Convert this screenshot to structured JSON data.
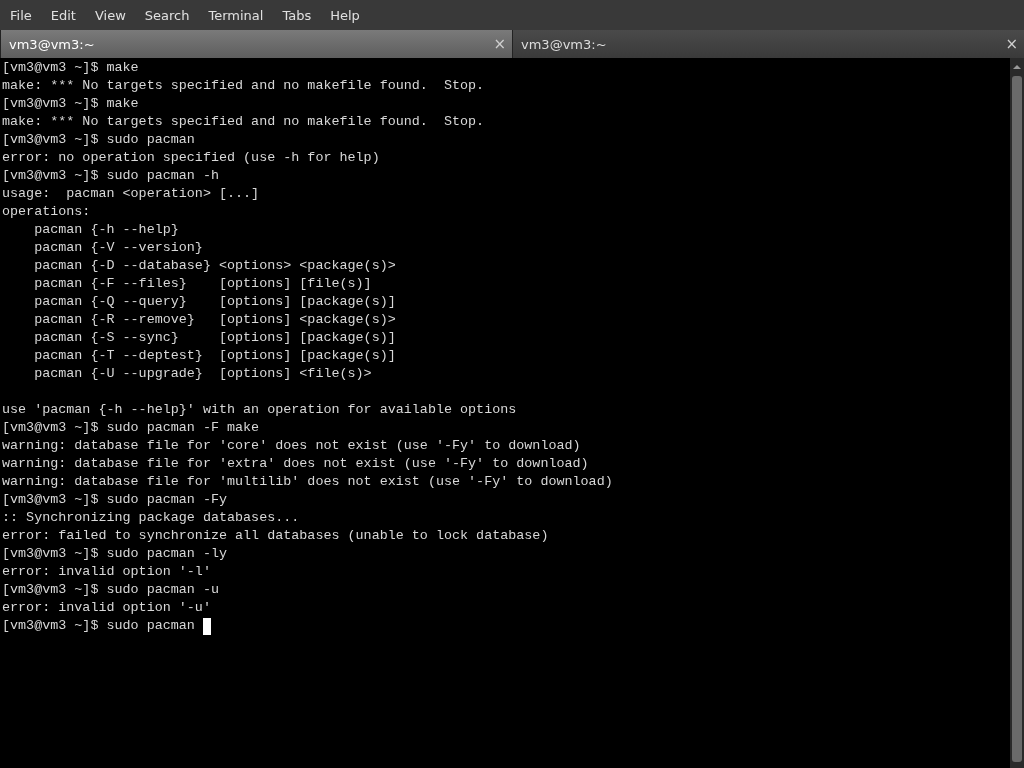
{
  "menu_bar": [
    "File",
    "Edit",
    "View",
    "Search",
    "Terminal",
    "Tabs",
    "Help"
  ],
  "tabs": [
    {
      "label": "vm3@vm3:~",
      "selected": true,
      "close": "×"
    },
    {
      "label": "vm3@vm3:~",
      "selected": false,
      "close": "×"
    }
  ],
  "terminal": {
    "lines": [
      {
        "text": "[vm3@vm3 ~]$ make",
        "cursor": false
      },
      {
        "text": "make: *** No targets specified and no makefile found.  Stop.",
        "cursor": false
      },
      {
        "text": "[vm3@vm3 ~]$ make",
        "cursor": false
      },
      {
        "text": "make: *** No targets specified and no makefile found.  Stop.",
        "cursor": false
      },
      {
        "text": "[vm3@vm3 ~]$ sudo pacman",
        "cursor": false
      },
      {
        "text": "error: no operation specified (use -h for help)",
        "cursor": false
      },
      {
        "text": "[vm3@vm3 ~]$ sudo pacman -h",
        "cursor": false
      },
      {
        "text": "usage:  pacman <operation> [...]",
        "cursor": false
      },
      {
        "text": "operations:",
        "cursor": false
      },
      {
        "text": "    pacman {-h --help}",
        "cursor": false
      },
      {
        "text": "    pacman {-V --version}",
        "cursor": false
      },
      {
        "text": "    pacman {-D --database} <options> <package(s)>",
        "cursor": false
      },
      {
        "text": "    pacman {-F --files}    [options] [file(s)]",
        "cursor": false
      },
      {
        "text": "    pacman {-Q --query}    [options] [package(s)]",
        "cursor": false
      },
      {
        "text": "    pacman {-R --remove}   [options] <package(s)>",
        "cursor": false
      },
      {
        "text": "    pacman {-S --sync}     [options] [package(s)]",
        "cursor": false
      },
      {
        "text": "    pacman {-T --deptest}  [options] [package(s)]",
        "cursor": false
      },
      {
        "text": "    pacman {-U --upgrade}  [options] <file(s)>",
        "cursor": false
      },
      {
        "cursor": false
      },
      {
        "text": "use 'pacman {-h --help}' with an operation for available options",
        "cursor": false
      },
      {
        "text": "[vm3@vm3 ~]$ sudo pacman -F make",
        "cursor": false
      },
      {
        "text": "warning: database file for 'core' does not exist (use '-Fy' to download)",
        "cursor": false
      },
      {
        "text": "warning: database file for 'extra' does not exist (use '-Fy' to download)",
        "cursor": false
      },
      {
        "text": "warning: database file for 'multilib' does not exist (use '-Fy' to download)",
        "cursor": false
      },
      {
        "text": "[vm3@vm3 ~]$ sudo pacman -Fy",
        "cursor": false
      },
      {
        "text": ":: Synchronizing package databases...",
        "cursor": false
      },
      {
        "text": "error: failed to synchronize all databases (unable to lock database)",
        "cursor": false
      },
      {
        "text": "[vm3@vm3 ~]$ sudo pacman -ly",
        "cursor": false
      },
      {
        "text": "error: invalid option '-l'",
        "cursor": false
      },
      {
        "text": "[vm3@vm3 ~]$ sudo pacman -u",
        "cursor": false
      },
      {
        "text": "error: invalid option '-u'",
        "cursor": false
      },
      {
        "text": "[vm3@vm3 ~]$ sudo pacman ",
        "cursor": true
      }
    ]
  }
}
